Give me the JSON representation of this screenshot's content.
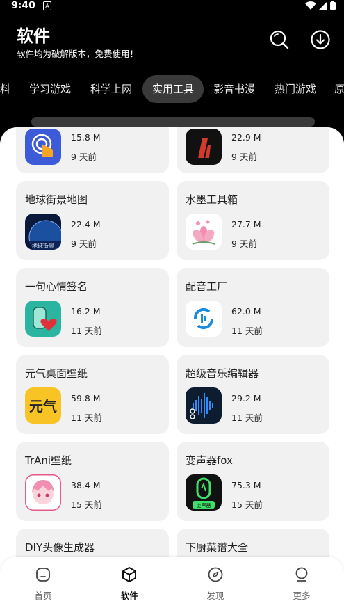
{
  "status_bar": {
    "time": "9:40",
    "sim_icon": "A"
  },
  "header": {
    "title": "软件",
    "subtitle": "软件均为破解版本，免费使用！"
  },
  "tabs": [
    "料",
    "学习游戏",
    "科学上网",
    "实用工具",
    "影音书漫",
    "热门游戏",
    "原"
  ],
  "active_tab": "实用工具",
  "apps": [
    {
      "name": "",
      "size": "15.8 M",
      "time": "9 天前",
      "icon": "tap-app-icon",
      "color": "#3d5bd9"
    },
    {
      "name": "",
      "size": "22.9 M",
      "time": "9 天前",
      "icon": "red-logo-icon",
      "color": "#111111"
    },
    {
      "name": "地球街景地图",
      "size": "22.4 M",
      "time": "9 天前",
      "icon": "earth-map-icon",
      "color": "#0b1a3a"
    },
    {
      "name": "水墨工具箱",
      "size": "27.7 M",
      "time": "9 天前",
      "icon": "lotus-icon",
      "color": "#ffffff"
    },
    {
      "name": "一句心情签名",
      "size": "16.2 M",
      "time": "11 天前",
      "icon": "heart-bottle-icon",
      "color": "#2bb5a0"
    },
    {
      "name": "配音工厂",
      "size": "62.0 M",
      "time": "11 天前",
      "icon": "dubbing-icon",
      "color": "#ffffff"
    },
    {
      "name": "元气桌面壁纸",
      "size": "59.8 M",
      "time": "11 天前",
      "icon": "yuanqi-icon",
      "color": "#f7c325"
    },
    {
      "name": "超级音乐编辑器",
      "size": "29.2 M",
      "time": "11 天前",
      "icon": "music-editor-icon",
      "color": "#0d1c2e"
    },
    {
      "name": "TrAni壁纸",
      "size": "38.4 M",
      "time": "15 天前",
      "icon": "anime-girl-icon",
      "color": "#f6b6c8"
    },
    {
      "name": "变声器fox",
      "size": "75.3 M",
      "time": "15 天前",
      "icon": "voice-changer-icon",
      "color": "#111111"
    },
    {
      "name": "DIY头像生成器",
      "size": "",
      "time": "",
      "icon": "avatar-maker-icon",
      "color": "#f1f1f1"
    },
    {
      "name": "下厨菜谱大全",
      "size": "",
      "time": "",
      "icon": "recipe-icon",
      "color": "#f1f1f1"
    }
  ],
  "icon_labels": {
    "earth": "地球街景",
    "yuanqi": "元气",
    "voice": "变声器"
  },
  "bottom_nav": [
    {
      "label": "首页",
      "icon": "home-icon"
    },
    {
      "label": "软件",
      "icon": "cube-icon"
    },
    {
      "label": "发现",
      "icon": "compass-icon"
    },
    {
      "label": "更多",
      "icon": "more-icon"
    }
  ],
  "active_nav": "软件"
}
